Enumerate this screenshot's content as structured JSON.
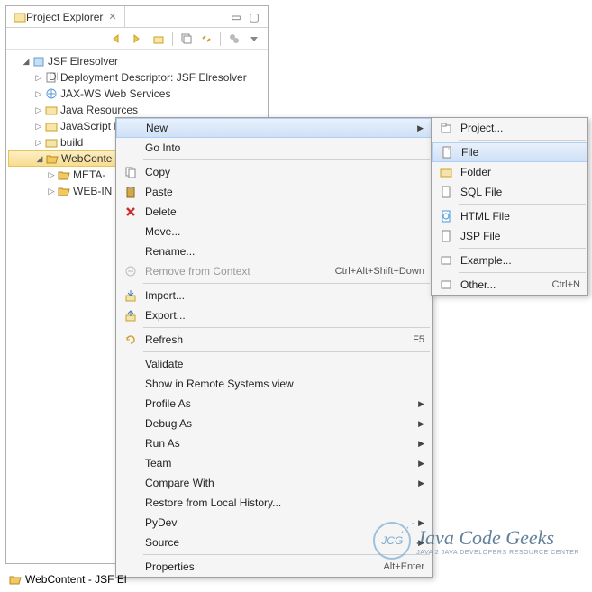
{
  "panel": {
    "title": "Project Explorer"
  },
  "tree": {
    "root": "JSF Elresolver",
    "items": [
      "Deployment Descriptor: JSF Elresolver",
      "JAX-WS Web Services",
      "Java Resources",
      "JavaScript R",
      "build",
      "WebConte",
      "META-",
      "WEB-IN"
    ]
  },
  "context_menu": {
    "new": "New",
    "go_into": "Go Into",
    "copy": "Copy",
    "paste": "Paste",
    "delete": "Delete",
    "move": "Move...",
    "rename": "Rename...",
    "remove_context": "Remove from Context",
    "remove_context_key": "Ctrl+Alt+Shift+Down",
    "import": "Import...",
    "export": "Export...",
    "refresh": "Refresh",
    "refresh_key": "F5",
    "validate": "Validate",
    "show_remote": "Show in Remote Systems view",
    "profile_as": "Profile As",
    "debug_as": "Debug As",
    "run_as": "Run As",
    "team": "Team",
    "compare_with": "Compare With",
    "restore_history": "Restore from Local History...",
    "pydev": "PyDev",
    "source": "Source",
    "properties": "Properties",
    "properties_key": "Alt+Enter"
  },
  "submenu": {
    "project": "Project...",
    "file": "File",
    "folder": "Folder",
    "sql_file": "SQL File",
    "html_file": "HTML File",
    "jsp_file": "JSP File",
    "example": "Example...",
    "other": "Other...",
    "other_key": "Ctrl+N"
  },
  "status": {
    "text": "WebContent - JSF El"
  },
  "watermark": {
    "circle": "JCG",
    "main": "Java Code Geeks",
    "sub": "JAVA 2 JAVA DEVELOPERS RESOURCE CENTER"
  }
}
